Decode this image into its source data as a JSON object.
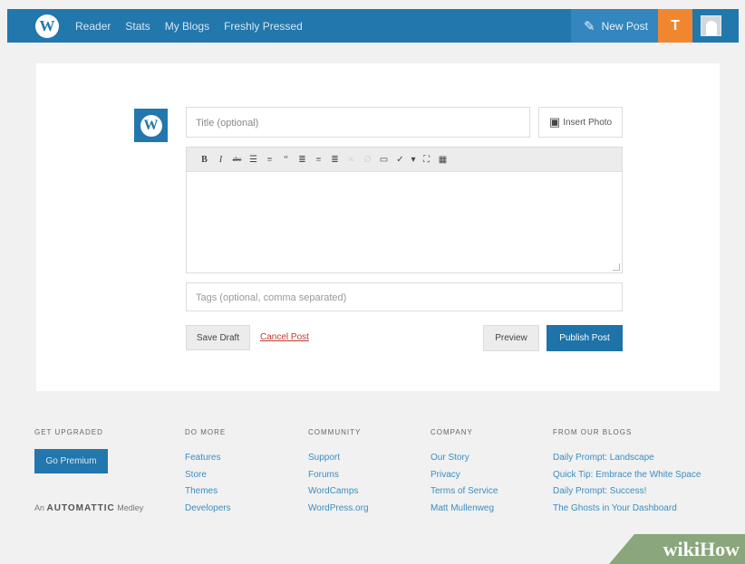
{
  "topbar": {
    "nav": [
      "Reader",
      "Stats",
      "My Blogs",
      "Freshly Pressed"
    ],
    "new_post": "New Post"
  },
  "editor": {
    "title_placeholder": "Title (optional)",
    "insert_photo": "Insert Photo",
    "toolbar_icons": [
      "bold-icon",
      "italic-icon",
      "strikethrough-icon",
      "bullet-list-icon",
      "numbered-list-icon",
      "blockquote-icon",
      "align-left-icon",
      "align-center-icon",
      "align-right-icon",
      "link-icon",
      "unlink-icon",
      "more-tag-icon",
      "spellcheck-icon",
      "dropdown-icon",
      "fullscreen-icon",
      "kitchen-sink-icon"
    ],
    "tags_placeholder": "Tags (optional, comma separated)",
    "save_draft": "Save Draft",
    "cancel_post": "Cancel Post",
    "preview": "Preview",
    "publish": "Publish Post"
  },
  "footer": {
    "upgrade_head": "GET UPGRADED",
    "go_premium": "Go Premium",
    "automattic_prefix": "An",
    "automattic_brand": "AUTOMATTIC",
    "automattic_suffix": "Medley",
    "columns": [
      {
        "head": "DO MORE",
        "links": [
          "Features",
          "Store",
          "Themes",
          "Developers"
        ]
      },
      {
        "head": "COMMUNITY",
        "links": [
          "Support",
          "Forums",
          "WordCamps",
          "WordPress.org"
        ]
      },
      {
        "head": "COMPANY",
        "links": [
          "Our Story",
          "Privacy",
          "Terms of Service",
          "Matt Mullenweg"
        ]
      },
      {
        "head": "FROM OUR BLOGS",
        "links": [
          "Daily Prompt: Landscape",
          "Quick Tip: Embrace the White Space",
          "Daily Prompt: Success!",
          "The Ghosts in Your Dashboard"
        ]
      }
    ]
  },
  "watermark": {
    "a": "wiki",
    "b": "How"
  }
}
